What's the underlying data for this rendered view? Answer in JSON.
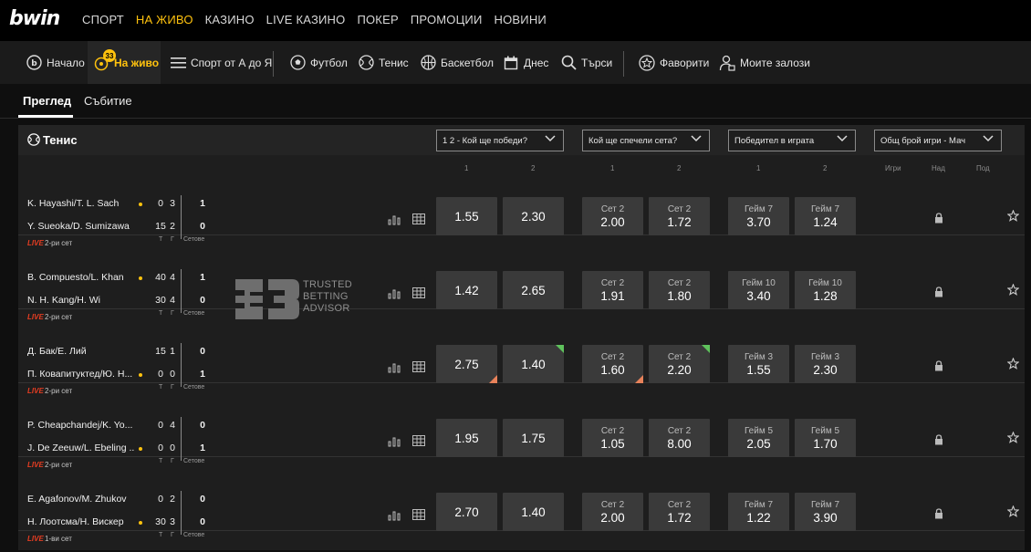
{
  "brand": {
    "logo": "bwin",
    "accent": "#ffc20e",
    "live_color": "#e63d22"
  },
  "topnav": [
    "СПОРТ",
    "НА ЖИВО",
    "КАЗИНО",
    "LIVE КАЗИНО",
    "ПОКЕР",
    "ПРОМОЦИИ",
    "НОВИНИ"
  ],
  "topnav_active": "НА ЖИВО",
  "subnav": {
    "home": "Начало",
    "live": "На живо",
    "live_count": "33",
    "a_to_z": "Спорт от А до Я",
    "football": "Футбол",
    "tennis": "Тенис",
    "basketball": "Баскетбол",
    "today": "Днес",
    "search": "Търси",
    "favorites": "Фаворити",
    "my_bets": "Моите залози"
  },
  "tabs": {
    "overview": "Преглед",
    "event": "Събитие"
  },
  "sport": {
    "title": "Тенис"
  },
  "markets": [
    {
      "label": "1 2 - Кой ще победи?",
      "cols": [
        "1",
        "2"
      ]
    },
    {
      "label": "Кой ще спечели сета?",
      "cols": [
        "1",
        "2"
      ]
    },
    {
      "label": "Победител в играта",
      "cols": [
        "1",
        "2"
      ]
    },
    {
      "label": "Общ брой игри - Мач",
      "cols": [
        "Игри",
        "Над",
        "Под"
      ]
    }
  ],
  "score_labels": {
    "t": "Т",
    "g": "Г",
    "sets": "Сетове"
  },
  "live_label": "LIVE",
  "watermark": {
    "line1": "TRUSTED",
    "line2": "BETTING",
    "line3": "ADVISOR"
  },
  "matches": [
    {
      "p1": "K. Hayashi/T. L. Sach",
      "p2": "Y. Sueoka/D. Sumizawa",
      "p1_pts": "0",
      "p1_games": "3",
      "p1_sets": "1",
      "p2_pts": "15",
      "p2_games": "2",
      "p2_sets": "0",
      "phase": "2-ри сет",
      "winner": [
        "1.55",
        "2.30"
      ],
      "set_h": [
        "Сет 2",
        "Сет 2"
      ],
      "set": [
        "2.00",
        "1.72"
      ],
      "game_h": [
        "Гейм 7",
        "Гейм 7"
      ],
      "game": [
        "3.70",
        "1.24"
      ]
    },
    {
      "p1": "B. Compuesto/L. Khan",
      "p2": "N. H. Kang/H. Wi",
      "p1_pts": "40",
      "p1_games": "4",
      "p1_sets": "1",
      "p2_pts": "30",
      "p2_games": "4",
      "p2_sets": "0",
      "phase": "2-ри сет",
      "winner": [
        "1.42",
        "2.65"
      ],
      "set_h": [
        "Сет 2",
        "Сет 2"
      ],
      "set": [
        "1.91",
        "1.80"
      ],
      "game_h": [
        "Гейм 10",
        "Гейм 10"
      ],
      "game": [
        "3.40",
        "1.28"
      ]
    },
    {
      "p1": "Д. Бак/Е. Лий",
      "p2": "П. Ковапитуктед/Ю. Н...",
      "p1_pts": "15",
      "p1_games": "1",
      "p1_sets": "0",
      "p2_pts": "0",
      "p2_games": "0",
      "p2_sets": "1",
      "phase": "2-ри сет",
      "winner": [
        "2.75",
        "1.40"
      ],
      "set_h": [
        "Сет 2",
        "Сет 2"
      ],
      "set": [
        "1.60",
        "2.20"
      ],
      "game_h": [
        "Гейм 3",
        "Гейм 3"
      ],
      "game": [
        "1.55",
        "2.30"
      ]
    },
    {
      "p1": "P. Cheapchandej/K. Yo...",
      "p2": "J. De Zeeuw/L. Ebeling ...",
      "p1_pts": "0",
      "p1_games": "4",
      "p1_sets": "0",
      "p2_pts": "0",
      "p2_games": "0",
      "p2_sets": "1",
      "phase": "2-ри сет",
      "winner": [
        "1.95",
        "1.75"
      ],
      "set_h": [
        "Сет 2",
        "Сет 2"
      ],
      "set": [
        "1.05",
        "8.00"
      ],
      "game_h": [
        "Гейм 5",
        "Гейм 5"
      ],
      "game": [
        "2.05",
        "1.70"
      ]
    },
    {
      "p1": "E. Agafonov/M. Zhukov",
      "p2": "Н. Лоотсма/Н. Вискер",
      "p1_pts": "0",
      "p1_games": "2",
      "p1_sets": "0",
      "p2_pts": "30",
      "p2_games": "3",
      "p2_sets": "0",
      "phase": "1-ви сет",
      "winner": [
        "2.70",
        "1.40"
      ],
      "set_h": [
        "Сет 2",
        "Сет 2"
      ],
      "set": [
        "2.00",
        "1.72"
      ],
      "game_h": [
        "Гейм 7",
        "Гейм 7"
      ],
      "game": [
        "1.22",
        "3.90"
      ]
    }
  ]
}
